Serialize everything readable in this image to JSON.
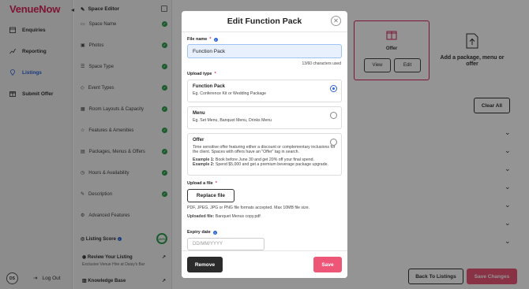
{
  "brand": {
    "logo": "VenueNow",
    "accent": "#d6265c",
    "link": "#2b63d9",
    "success": "#2f9e4f"
  },
  "nav": {
    "items": [
      {
        "label": "Enquiries",
        "icon": "calendar-icon"
      },
      {
        "label": "Reporting",
        "icon": "chart-icon"
      },
      {
        "label": "Listings",
        "icon": "location-pin-icon",
        "active": true
      },
      {
        "label": "Submit Offer",
        "icon": "gift-icon"
      }
    ],
    "user_initials": "DS",
    "logout": "Log Out"
  },
  "editor": {
    "title": "Space Editor",
    "items": [
      "Space Name",
      "Photos",
      "Space Type",
      "Event Types",
      "Room Layouts & Capacity",
      "Features & Amenities",
      "Packages, Menus & Offers",
      "Hours & Availability",
      "Description",
      "Advanced Features"
    ],
    "score_label": "Listing Score",
    "score_value": "100%",
    "review": {
      "title": "Review Your Listing",
      "sub": "Exclusive Venue Hire at Daisy's Bar"
    },
    "kb": {
      "title": "Knowledge Base"
    }
  },
  "main": {
    "offer_label": "Offer",
    "view": "View",
    "edit": "Edit",
    "add_card": "Add a package, menu or offer",
    "clear_all": "Clear All",
    "back": "Back To Listings",
    "save_changes": "Save Changes"
  },
  "modal": {
    "title": "Edit Function Pack",
    "file_name_label": "File name",
    "file_name_value": "Function Pack",
    "char_count": "13/60 characters used",
    "upload_type_label": "Upload type",
    "options": [
      {
        "title": "Function Pack",
        "desc": "Eg. Conference Kit or Wedding Package",
        "selected": true
      },
      {
        "title": "Menu",
        "desc": "Eg. Set Menu, Banquet Menu, Drinks Menu",
        "selected": false
      },
      {
        "title": "Offer",
        "desc": "Time sensitive offer featuring either a discount or complementary inclusions for the client. Spaces with offers have an \"Offer\" tag in search.",
        "ex1_label": "Example 1:",
        "ex1": "Book before June 30 and get 20% off your final spend.",
        "ex2_label": "Example 2:",
        "ex2": "Spend $5,000 and get a premium beverage package upgrade.",
        "selected": false
      }
    ],
    "upload_label": "Upload a file",
    "replace_button": "Replace file",
    "formats": "PDF, JPEG, JPG or PNG file formats accepted. Max 10MB file size.",
    "uploaded_label": "Uploaded file:",
    "uploaded_file": "Banquet Menus copy.pdf",
    "expiry_label": "Expiry date",
    "expiry_placeholder": "DD/MM/YYYY",
    "remove": "Remove",
    "save": "Save"
  }
}
